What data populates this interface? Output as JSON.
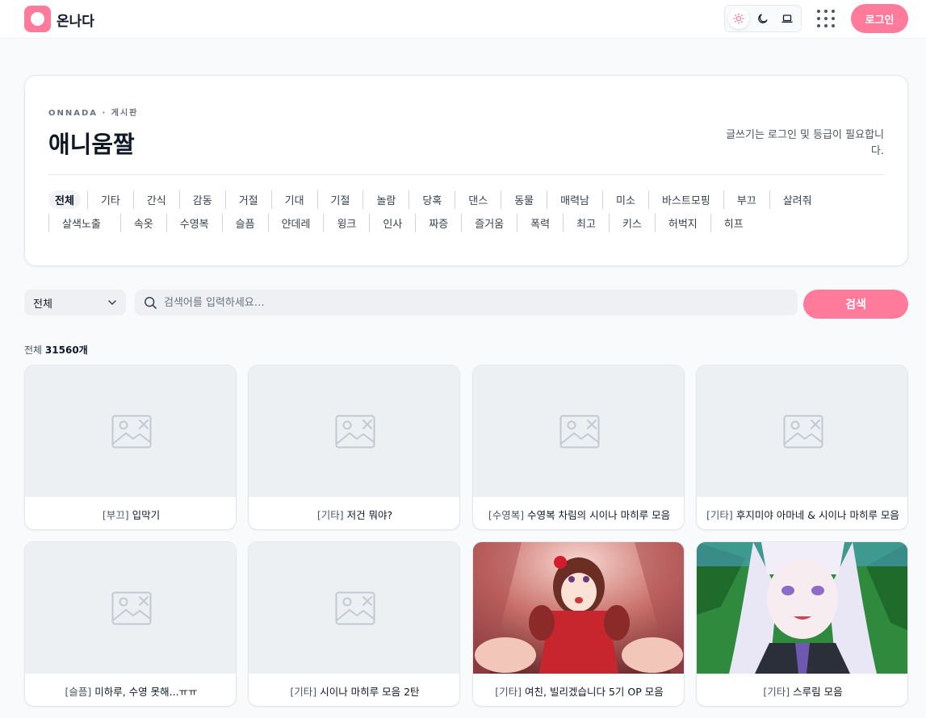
{
  "header": {
    "site_name": "온나다",
    "login_label": "로그인",
    "theme_icons": [
      "sun-icon",
      "moon-icon",
      "laptop-icon"
    ],
    "accent": "#ff7a9b"
  },
  "board": {
    "eyebrow": "ONNADA · 게시판",
    "title": "애니움짤",
    "notice": "글쓰기는 로그인 및 등급이 필요합니다.",
    "categories": [
      "전체",
      "기타",
      "간식",
      "감동",
      "거절",
      "기대",
      "기절",
      "놀람",
      "당혹",
      "댄스",
      "동물",
      "매력남",
      "미소",
      "바스트모핑",
      "부끄",
      "살려줘",
      "살색노출",
      "속옷",
      "수영복",
      "슬픔",
      "얀데레",
      "윙크",
      "인사",
      "짜증",
      "즐거움",
      "폭력",
      "최고",
      "키스",
      "허벅지",
      "히프"
    ]
  },
  "search": {
    "select_value": "전체",
    "placeholder": "검색어를 입력하세요…",
    "button_label": "검색"
  },
  "count": {
    "prefix": "전체",
    "value": "31560개"
  },
  "posts": [
    {
      "tag": "[부끄]",
      "title": "입막기",
      "thumb": "placeholder"
    },
    {
      "tag": "[기타]",
      "title": "저건 뭐야?",
      "thumb": "placeholder"
    },
    {
      "tag": "[수영복]",
      "title": "수영복 차림의 시이나 마히루 모음",
      "thumb": "placeholder"
    },
    {
      "tag": "[기타]",
      "title": "후지미야 아마네 & 시이나 마히루 모음",
      "thumb": "placeholder"
    },
    {
      "tag": "[슬픔]",
      "title": "미하루, 수영 못해...ㅠㅠ",
      "thumb": "placeholder"
    },
    {
      "tag": "[기타]",
      "title": "시이나 마히루 모음 2탄",
      "thumb": "placeholder"
    },
    {
      "tag": "[기타]",
      "title": "여친, 빌리겠습니다 5기 OP 모음",
      "thumb": "anime-stage"
    },
    {
      "tag": "[기타]",
      "title": "스루림 모음",
      "thumb": "anime-forest"
    }
  ]
}
